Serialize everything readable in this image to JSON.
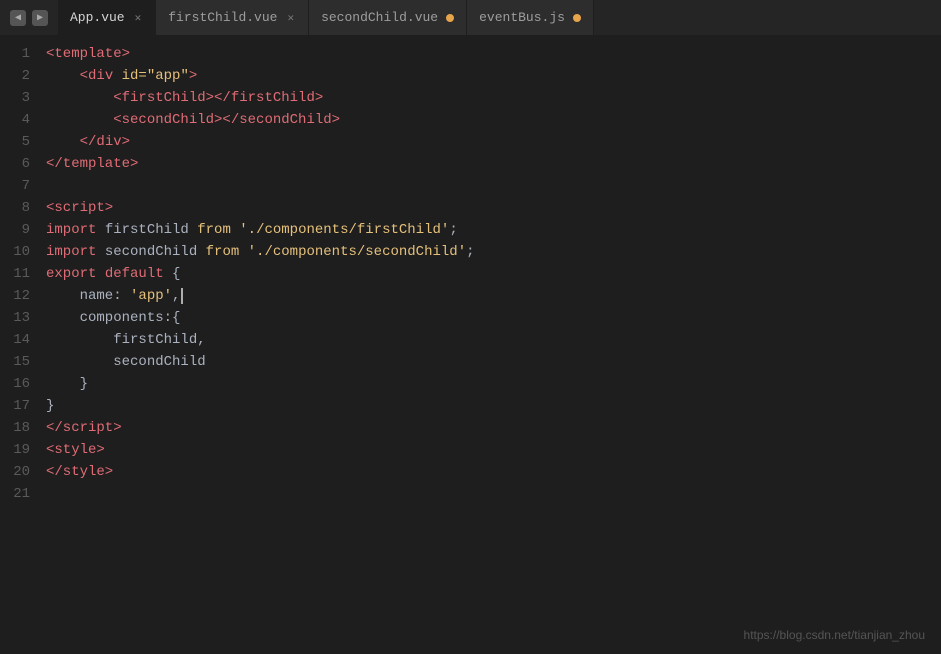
{
  "titlebar": {
    "back_label": "◀",
    "forward_label": "▶"
  },
  "tabs": [
    {
      "label": "App.vue",
      "active": true,
      "has_close": true,
      "has_dot": false
    },
    {
      "label": "firstChild.vue",
      "active": false,
      "has_close": true,
      "has_dot": false
    },
    {
      "label": "secondChild.vue",
      "active": false,
      "has_close": false,
      "has_dot": true
    },
    {
      "label": "eventBus.js",
      "active": false,
      "has_close": false,
      "has_dot": true
    }
  ],
  "lines": [
    "1",
    "2",
    "3",
    "4",
    "5",
    "6",
    "7",
    "8",
    "9",
    "10",
    "11",
    "12",
    "13",
    "14",
    "15",
    "16",
    "17",
    "18",
    "19",
    "20",
    "21"
  ],
  "watermark": "https://blog.csdn.net/tianjian_zhou"
}
